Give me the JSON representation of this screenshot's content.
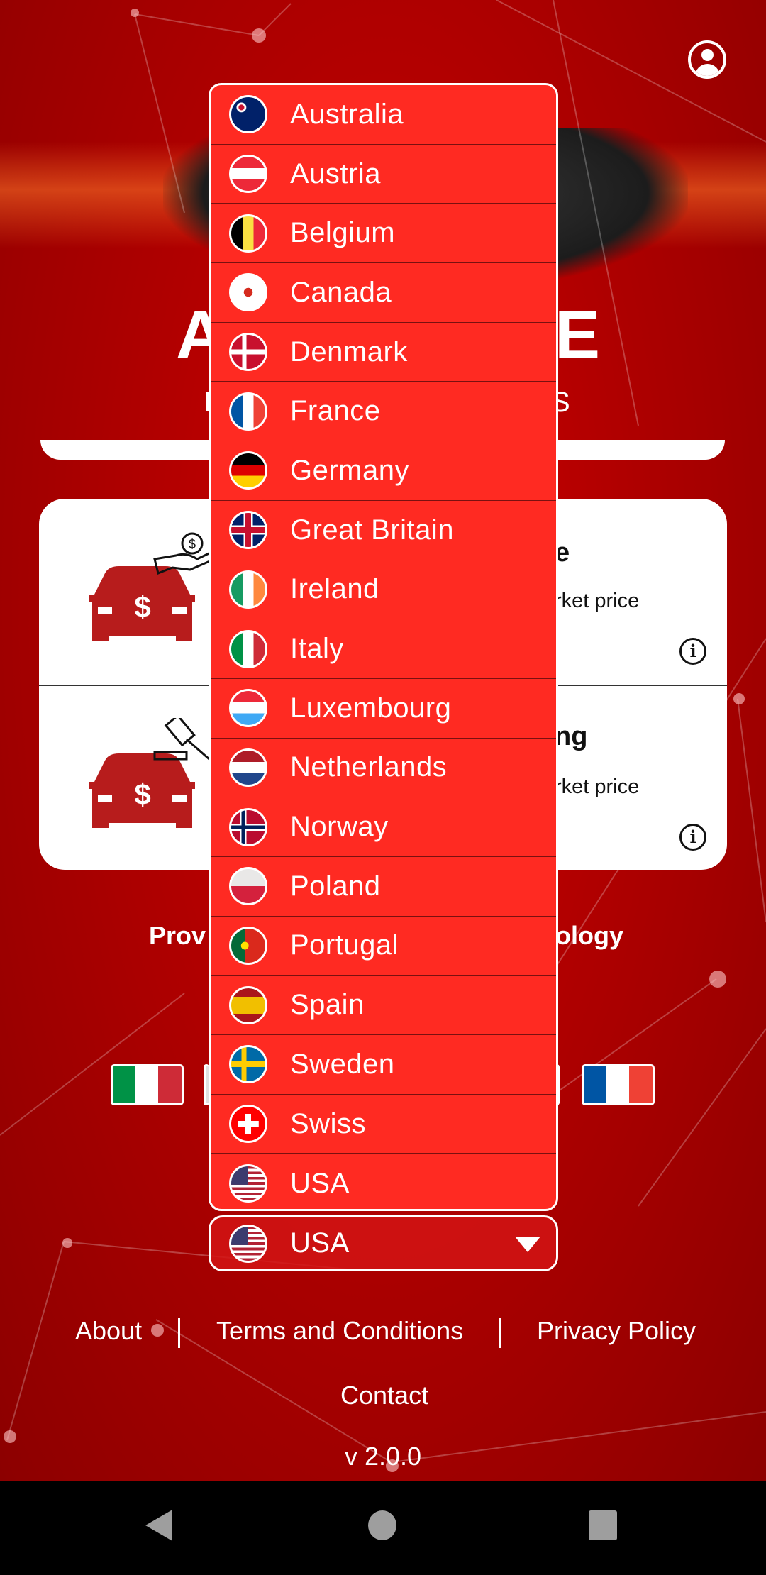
{
  "hero": {
    "title_left_fragment": "A",
    "title_right_fragment": "E",
    "subtitle_left_fragment": "I",
    "subtitle_right_fragment": "S"
  },
  "cards": [
    {
      "title_fragment": "e",
      "desc_fragment": "rket price",
      "icon": "car-dollar-hand-icon"
    },
    {
      "title_fragment": "ng",
      "desc_fragment": "rket price",
      "icon": "car-dollar-gavel-icon"
    }
  ],
  "tagline": {
    "left_fragment": "Prov",
    "right_fragment": "ology"
  },
  "language_flags": [
    "it",
    "fr"
  ],
  "country_dropdown": {
    "options": [
      {
        "label": "Australia",
        "flag": "au"
      },
      {
        "label": "Austria",
        "flag": "at"
      },
      {
        "label": "Belgium",
        "flag": "be"
      },
      {
        "label": "Canada",
        "flag": "ca"
      },
      {
        "label": "Denmark",
        "flag": "dk"
      },
      {
        "label": "France",
        "flag": "fr"
      },
      {
        "label": "Germany",
        "flag": "de"
      },
      {
        "label": "Great Britain",
        "flag": "gb"
      },
      {
        "label": "Ireland",
        "flag": "ie"
      },
      {
        "label": "Italy",
        "flag": "it"
      },
      {
        "label": "Luxembourg",
        "flag": "lu"
      },
      {
        "label": "Netherlands",
        "flag": "nl"
      },
      {
        "label": "Norway",
        "flag": "no"
      },
      {
        "label": "Poland",
        "flag": "pl"
      },
      {
        "label": "Portugal",
        "flag": "pt"
      },
      {
        "label": "Spain",
        "flag": "es"
      },
      {
        "label": "Sweden",
        "flag": "se"
      },
      {
        "label": "Swiss",
        "flag": "ch"
      },
      {
        "label": "USA",
        "flag": "us"
      }
    ],
    "selected": {
      "label": "USA",
      "flag": "us"
    },
    "accent": "#ff2a22"
  },
  "footer": {
    "about": "About",
    "terms": "Terms and Conditions",
    "privacy": "Privacy Policy",
    "contact": "Contact",
    "version": "v 2.0.0"
  },
  "flag_styles": {
    "au": "radial-gradient(circle at 30% 30%,#c8102e 0 8%,#fff 9% 14%,#012169 15%)",
    "at": "linear-gradient(#ed2939 0 33%,#fff 33% 66%,#ed2939 66%)",
    "be": "linear-gradient(90deg,#000 0 33%,#fae042 33% 66%,#ed2939 66%)",
    "ca": "radial-gradient(circle,#d52b1e 0 18%,#fff 19%) center/100% 100%,linear-gradient(90deg,#d52b1e 0 25%,#fff 25% 75%,#d52b1e 75%)",
    "dk": "linear-gradient(90deg,transparent 0 32%,#fff 32% 45%,transparent 45%),linear-gradient(transparent 0 43%,#fff 43% 57%,transparent 57%),#c8102e",
    "fr": "linear-gradient(90deg,#0055a4 0 33%,#fff 33% 66%,#ef4135 66%)",
    "de": "linear-gradient(#000 0 33%,#dd0000 33% 66%,#ffce00 66%)",
    "gb": "linear-gradient(90deg,transparent 0 42%,#c8102e 42% 58%,transparent 58%),linear-gradient(transparent 0 42%,#c8102e 42% 58%,transparent 58%),linear-gradient(90deg,transparent 0 36%,#fff 36% 64%,transparent 64%),linear-gradient(transparent 0 36%,#fff 36% 64%,transparent 64%),#012169",
    "ie": "linear-gradient(90deg,#169b62 0 33%,#fff 33% 66%,#ff883e 66%)",
    "it": "linear-gradient(90deg,#009246 0 33%,#fff 33% 66%,#ce2b37 66%)",
    "lu": "linear-gradient(#ed2939 0 33%,#fff 33% 66%,#3fa9f5 66%)",
    "nl": "linear-gradient(#ae1c28 0 33%,#fff 33% 66%,#21468b 66%)",
    "no": "linear-gradient(90deg,transparent 0 30%,#00205b 30% 40%,transparent 40%),linear-gradient(transparent 0 45%,#00205b 45% 55%,transparent 55%),linear-gradient(90deg,transparent 0 25%,#fff 25% 45%,transparent 45%),linear-gradient(transparent 0 40%,#fff 40% 60%,transparent 60%),#ba0c2f",
    "pl": "linear-gradient(#e9e8e7 0 50%,#d4213d 50%)",
    "pt": "radial-gradient(circle at 40% 50%,#ffe000 0 14%,transparent 15%),linear-gradient(90deg,#046a38 0 40%,#da291c 40%)",
    "es": "linear-gradient(#aa151b 0 25%,#f1bf00 25% 75%,#aa151b 75%)",
    "se": "linear-gradient(90deg,transparent 0 30%,#fecc02 30% 45%,transparent 45%),linear-gradient(transparent 0 42%,#fecc02 42% 58%,transparent 58%),#006aa7",
    "ch": "linear-gradient(90deg,transparent 0 42%,#fff 42% 58%,transparent 58%) center/100% 60% no-repeat,linear-gradient(transparent 0 42%,#fff 42% 58%,transparent 58%) center/60% 100% no-repeat,#ff0000",
    "us": "linear-gradient(#3c3b6e,#3c3b6e) 0 0/50% 54% no-repeat,repeating-linear-gradient(#b22234 0 7.7%,#fff 7.7% 15.4%)"
  }
}
